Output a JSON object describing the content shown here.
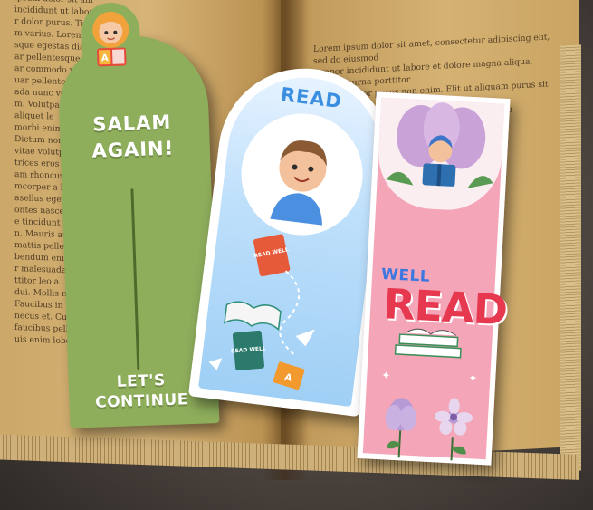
{
  "book": {
    "left_page_text": "ipsum dolor sit am\nincididunt ut labore\nr dolor purus. Tinc\nm varius. Lorem mollis\nsque egestas diam in arcu\nar pellentesque habitant\nar commodo viverra mauris\nuar pellentesque nunc\nada nunc vel risus\nm. Volutpat maecenas\naliquet le\nmorbi enim nunc\nDictum non consectetur\nvitae volutpat. Pellen\ntrices eros in cursus\nam rhoncus est pe\nmcorper a lacus\nasellus egestas tell\nontes nascetur ridic\ne tincidunt tortor\nn. Mauris augue\nmattis pellentesque\nbendum enim facilisis\nr malesuada nunc vel\nttitor leo a. Lectus ma\ndui. Mollis nunc sed\nFaucibus in ornare\nnecus et. Cursus risus\nfaucibus pellentesque. Aenean et\nuis enim lobortis scelerisque",
    "right_page_text": "Lorem ipsum dolor sit amet, consectetur adipiscing elit, sed do eiusmod\ntempor incididunt ut labore et dolore magna aliqua. Fringilla urna porttitor\nrhoncus dolor purus non enim. Elit ut aliquam purus sit amet luctus\nam lobortis feugiat vivamus at augue eget arcu\nvolutpat sed cras ornare arcu dui vivamus\naugue neque gravida in fermentum et\nat. Malesuada nunc\nnam at lectus urna.\naccumsan. Gravida\nhendrerit id\n\nvulputate ut\nstate odio ut\nmorbi non.\ndictumst\nvelit sed\ngestas sed\n\nis dis\nnam tellus\naliquam\nfaucibus\nipsum\ns vitae\nnibus\nsis\nis",
    "colors": {
      "page": "#d6b477",
      "text": "#3b2a18"
    }
  },
  "bookmarks": {
    "green": {
      "title_line1": "SALAM",
      "title_line2": "AGAIN!",
      "footer_line1": "LET'S",
      "footer_line2": "CONTINUE",
      "badge_letter": "A",
      "color": "#8fae5c"
    },
    "blue": {
      "title": "READ",
      "book1_label": "READ WELL",
      "book2_label": "READ WELL",
      "book3_letter": "A",
      "color": "#3a8ee0"
    },
    "pink": {
      "well": "WELL",
      "read": "READ",
      "color": "#f4a5b8",
      "accent": "#e6384f"
    }
  }
}
